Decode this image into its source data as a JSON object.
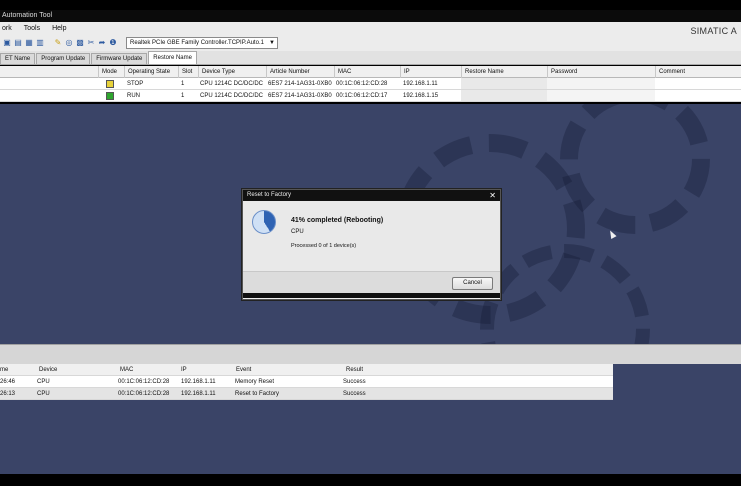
{
  "window": {
    "title": "Automation Tool",
    "brand": "SIMATIC A"
  },
  "menu": [
    "ork",
    "Tools",
    "Help"
  ],
  "toolbar": {
    "icons": [
      "folder-icon",
      "save-icon",
      "grid-icon",
      "list-icon",
      "key-icon",
      "refresh-icon",
      "chip-icon",
      "tools-icon",
      "flash-icon",
      "info-icon"
    ],
    "interface_select": "Realtek PCIe GBE Family Controller.TCPIP.Auto.1"
  },
  "tabs": [
    "ET Name",
    "Program Update",
    "Firmware Update",
    "Restore Name"
  ],
  "active_tab": "Restore Name",
  "device_table": {
    "columns": [
      "Mode",
      "Operating State",
      "Slot",
      "Device Type",
      "Article Number",
      "MAC",
      "IP",
      "Restore Name",
      "Password",
      "Comment"
    ],
    "rows": [
      {
        "mode_color": "#e8d23a",
        "state": "STOP",
        "slot": "1",
        "device_type": "CPU 1214C DC/DC/DC",
        "article": "6ES7 214-1AG31-0XB0",
        "mac": "00:1C:06:12:CD:28",
        "ip": "192.168.1.11"
      },
      {
        "mode_color": "#2ea52e",
        "state": "RUN",
        "slot": "1",
        "device_type": "CPU 1214C DC/DC/DC",
        "article": "6ES7 214-1AG31-0XB0",
        "mac": "00:1C:06:12:CD:17",
        "ip": "192.168.1.15"
      }
    ]
  },
  "dialog": {
    "title": "Reset to Factory",
    "progress_percent": 41,
    "status": "41%  completed  (Rebooting)",
    "device": "CPU",
    "processed": "Processed 0 of 1 device(s)",
    "cancel_label": "Cancel"
  },
  "log_table": {
    "columns": [
      "me",
      "Device",
      "MAC",
      "IP",
      "Event",
      "Result"
    ],
    "rows": [
      {
        "time": "26:46",
        "device": "CPU",
        "mac": "00:1C:06:12:CD:28",
        "ip": "192.168.1.11",
        "event": "Memory Reset",
        "result": "Success"
      },
      {
        "time": "26:13",
        "device": "CPU",
        "mac": "00:1C:06:12:CD:28",
        "ip": "192.168.1.11",
        "event": "Reset to Factory",
        "result": "Success"
      }
    ]
  }
}
